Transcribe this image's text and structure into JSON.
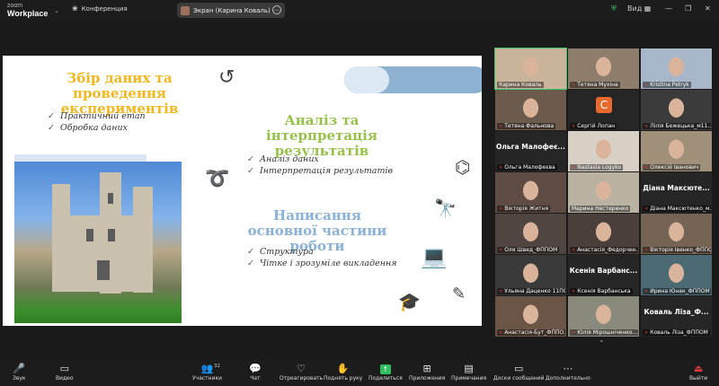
{
  "app": {
    "logo_top": "zoom",
    "logo_bottom": "Workplace",
    "conference_label": "Конференция",
    "screen_share_label": "Экран (Карина Коваль)",
    "view_label": "Вид"
  },
  "slide": {
    "h1": "Збір даних та проведення експериментів",
    "h1_items": [
      "Практичний етап",
      "Обробка даних"
    ],
    "h2": "Аналіз та інтерпретація результатів",
    "h2_items": [
      "Аналіз даних",
      "Інтерпретація результатів"
    ],
    "h3": "Написання основної частини роботи",
    "h3_items": [
      "Структура",
      "Чітке і зрозуміле викладення"
    ],
    "colors": {
      "h1": "#f0b81e",
      "h2": "#97c24a",
      "h3": "#8ab1d6"
    }
  },
  "gallery": {
    "tiles": [
      {
        "name": "Карина Коваль",
        "muted": false,
        "active": true,
        "kind": "video",
        "bg": "#c9b49a"
      },
      {
        "name": "Тетяна Мухіна",
        "muted": true,
        "kind": "video",
        "bg": "#8d7d6a"
      },
      {
        "name": "Kristina Petryk",
        "muted": true,
        "kind": "video",
        "bg": "#a7b7c9"
      },
      {
        "name": "Тетяна Фальнова",
        "muted": true,
        "kind": "video",
        "bg": "#6c5a4c"
      },
      {
        "name": "Сергій Лопан",
        "muted": true,
        "kind": "letter",
        "letter": "C",
        "bg": "#262626"
      },
      {
        "name": "Лілія Бежецька_м11...",
        "muted": true,
        "kind": "video",
        "bg": "#3b3b3b"
      },
      {
        "name": "Ольга Малофеєва",
        "muted": true,
        "kind": "name",
        "big": "Ольга Малофеє...",
        "bg": "#262626"
      },
      {
        "name": "Nastasia Logyko",
        "muted": true,
        "kind": "video",
        "bg": "#d8d0c4"
      },
      {
        "name": "Олексій Іванович",
        "muted": true,
        "kind": "video",
        "bg": "#a0907a"
      },
      {
        "name": "Вікторія Житня",
        "muted": true,
        "kind": "video",
        "bg": "#5e4b44"
      },
      {
        "name": "Марина Нестеренко",
        "muted": false,
        "kind": "video",
        "bg": "#b9b2a2"
      },
      {
        "name": "Діана Максютенко_м...",
        "muted": true,
        "kind": "name",
        "big": "Діана Максюте...",
        "bg": "#262626"
      },
      {
        "name": "Оля Швед_ФППОМ",
        "muted": true,
        "kind": "video",
        "bg": "#504540"
      },
      {
        "name": "Анастасія_Федорчен...",
        "muted": true,
        "kind": "video",
        "bg": "#4a3f3a"
      },
      {
        "name": "Вікторія Івенко_ФППОМ",
        "muted": true,
        "kind": "video",
        "bg": "#756354"
      },
      {
        "name": "Ульяна Даценко 11ПО",
        "muted": true,
        "kind": "video",
        "bg": "#3a3a3a"
      },
      {
        "name": "Ксенія Варбанська",
        "muted": true,
        "kind": "name",
        "big": "Ксенія Варбанс...",
        "bg": "#262626"
      },
      {
        "name": "Ирина Юнак_ФППОМ",
        "muted": true,
        "kind": "video",
        "bg": "#4c6a73"
      },
      {
        "name": "Анастасія-Бут_ФППО...",
        "muted": true,
        "kind": "video",
        "bg": "#6b5546"
      },
      {
        "name": "Юлія Мірошніченко...",
        "muted": true,
        "kind": "video",
        "bg": "#8a8a7c"
      },
      {
        "name": "Коваль Ліза_ФППОМ",
        "muted": true,
        "kind": "name",
        "big": "Коваль Ліза_Ф...",
        "bg": "#262626"
      }
    ]
  },
  "toolbar": {
    "audio": "Звук",
    "video": "Видео",
    "participants": "Участники",
    "participants_count": "32",
    "chat": "Чат",
    "react": "Отреагировать",
    "raise_hand": "Поднять руку",
    "share": "Поделиться",
    "apps": "Приложения",
    "notes": "Примечания",
    "share_screen_msgs": "Доски сообщений",
    "more": "Дополнительно",
    "leave": "Выйти"
  }
}
